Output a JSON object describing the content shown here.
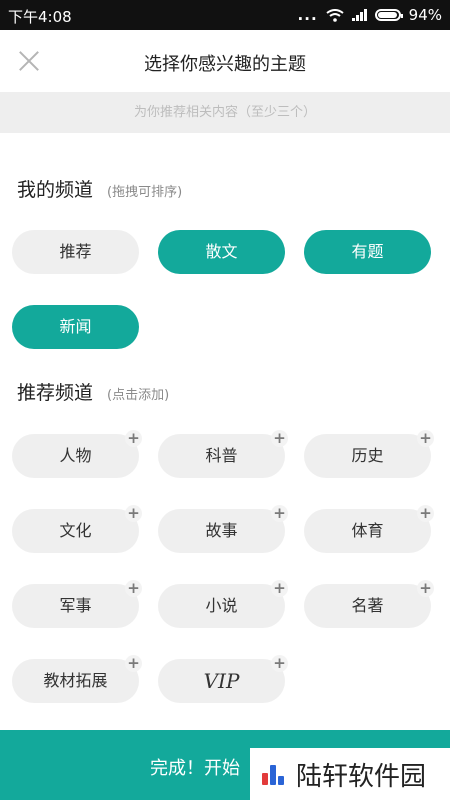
{
  "status": {
    "time": "下午4:08",
    "dots": "...",
    "battery_text": "94%",
    "battery_level": 0.94
  },
  "header": {
    "title": "选择你感兴趣的主题",
    "close_icon": "close-icon"
  },
  "subtitle": "为你推荐相关内容（至少三个）",
  "my_channels": {
    "title": "我的频道",
    "hint": "(拖拽可排序)",
    "items": [
      "推荐",
      "散文",
      "有题",
      "新闻"
    ]
  },
  "recommended": {
    "title": "推荐频道",
    "hint": "(点击添加)",
    "plus": "+",
    "items": [
      "人物",
      "科普",
      "历史",
      "文化",
      "故事",
      "体育",
      "军事",
      "小说",
      "名著",
      "教材拓展",
      "VIP"
    ]
  },
  "bottom": {
    "label": "完成！开始"
  },
  "watermark": {
    "text": "陆轩软件园"
  },
  "colors": {
    "accent": "#13a99b",
    "chip": "#efefef",
    "status_bar": "#111111"
  }
}
